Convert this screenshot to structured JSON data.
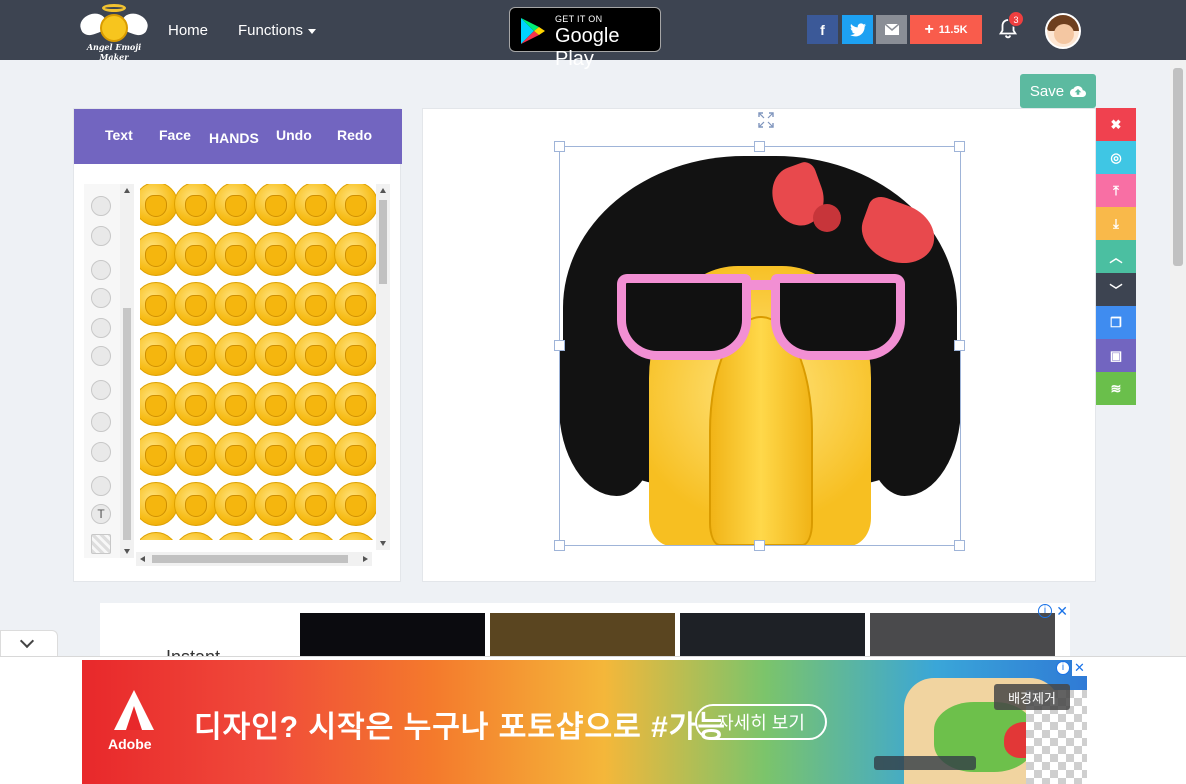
{
  "brand": {
    "logo_text": "Angel Emoji Maker"
  },
  "nav": {
    "home": "Home",
    "functions": "Functions"
  },
  "google_play": {
    "small": "GET IT ON",
    "big": "Google Play"
  },
  "social": {
    "facebook": "f",
    "twitter": "t",
    "plus_count": "11.5K"
  },
  "notifications": {
    "count": "3"
  },
  "toolbar": {
    "save_label": "Save"
  },
  "panel": {
    "tabs": [
      "Text",
      "Face",
      "HANDS",
      "Undo",
      "Redo"
    ],
    "active_tab": "HANDS",
    "text_tool_glyph": "T"
  },
  "ad_top": {
    "text": "Instant"
  },
  "ad_bottom": {
    "brand": "Adobe",
    "headline": "디자인? 시작은 누구나 포토샵으로 #가능",
    "cta": "자세히 보기",
    "bg_remove": "배경제거"
  },
  "colors": {
    "navbar": "#3d4451",
    "panel_header": "#7265c0",
    "save": "#5cbaa0",
    "rtools": [
      "#f0414f",
      "#3fc6e4",
      "#f86fa4",
      "#f9b94a",
      "#4bbfa1",
      "#3d4451",
      "#3f8cf0",
      "#7265c0",
      "#6abf4b"
    ]
  },
  "right_tools": [
    "close-icon",
    "center-icon",
    "bring-front-icon",
    "send-back-icon",
    "move-up-icon",
    "move-down-icon",
    "copy-icon",
    "paste-icon",
    "layers-icon"
  ]
}
